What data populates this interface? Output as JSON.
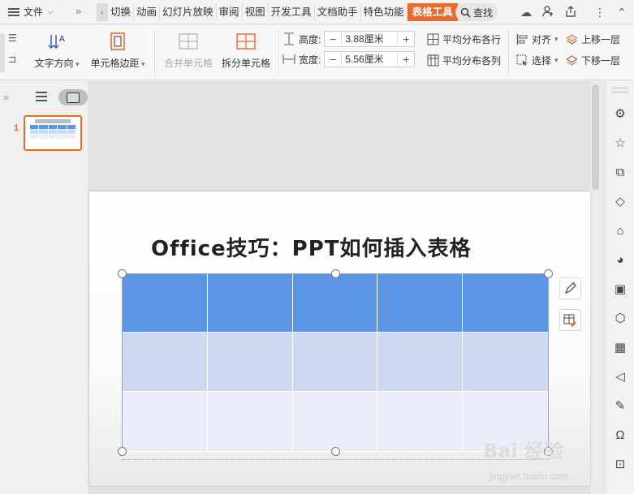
{
  "topbar": {
    "menu_label": "文件",
    "tabs": [
      "切换",
      "动画",
      "幻灯片放映",
      "审阅",
      "视图",
      "开发工具",
      "文档助手",
      "特色功能",
      "表格工具"
    ],
    "active_tab": "表格工具",
    "search_label": "查找"
  },
  "ribbon": {
    "text_direction": "文字方向",
    "cell_margin": "单元格边距",
    "merge_cells": "合并单元格",
    "split_cells": "拆分单元格",
    "height_label": "高度:",
    "height_value": "3.88厘米",
    "width_label": "宽度:",
    "width_value": "5.56厘米",
    "distribute_rows": "平均分布各行",
    "distribute_cols": "平均分布各列",
    "align": "对齐",
    "select": "选择",
    "bring_forward": "上移一层",
    "send_backward": "下移一层"
  },
  "left_panel": {
    "slide_number": "1"
  },
  "slide": {
    "title": "Office技巧：PPT如何插入表格",
    "table_rows": 3,
    "table_cols": 5,
    "colors": {
      "header": "#5b95e4",
      "row2": "#cdd9f2",
      "row3": "#e8edf8"
    }
  },
  "watermark": {
    "brand": "Bai 经验",
    "url": "jingyan.baidu.com"
  },
  "colors": {
    "accent": "#e86a2c"
  }
}
